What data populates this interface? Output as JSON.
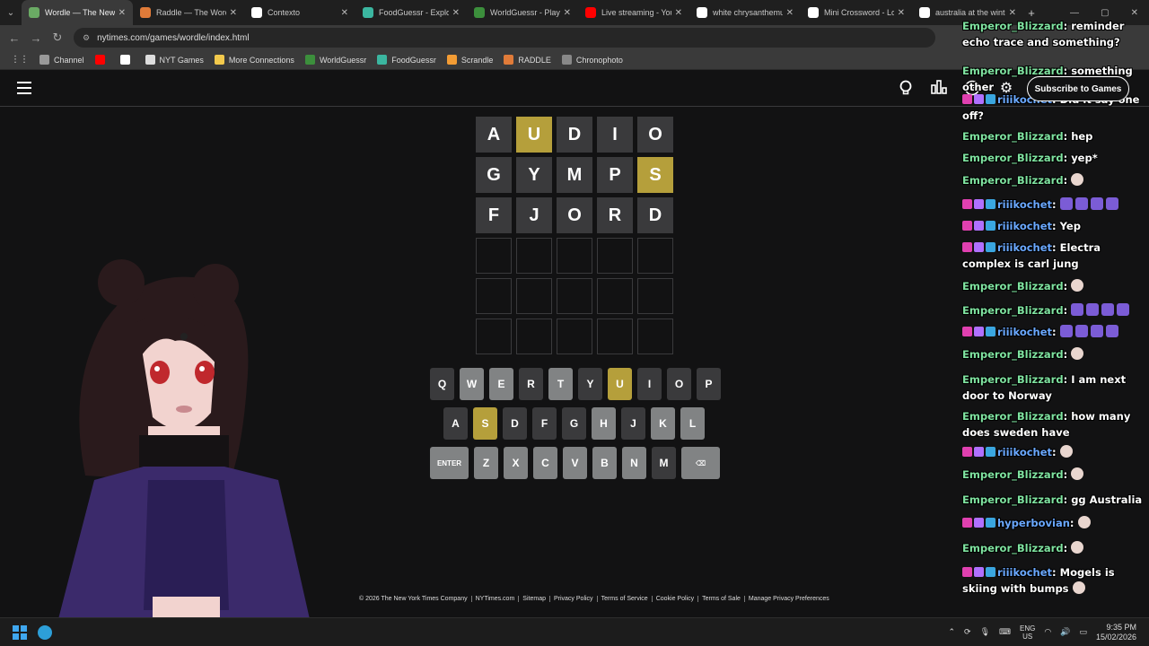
{
  "browser": {
    "tabs": [
      {
        "title": "Wordle — The New Y",
        "icon": "wordle-icon",
        "color": "#6aaa64",
        "active": true
      },
      {
        "title": "Raddle — The Word",
        "icon": "raddle-icon",
        "color": "#e07b39",
        "active": false
      },
      {
        "title": "Contexto",
        "icon": "contexto-icon",
        "color": "#ffffff",
        "active": false
      },
      {
        "title": "FoodGuessr - Explore",
        "icon": "foodguessr-icon",
        "color": "#3bb6a0",
        "active": false
      },
      {
        "title": "WorldGuessr - Play G",
        "icon": "worldguessr-icon",
        "color": "#3c8f3c",
        "active": false
      },
      {
        "title": "Live streaming - YouT",
        "icon": "youtube-icon",
        "color": "#ff0000",
        "active": false
      },
      {
        "title": "white chrysanthemum",
        "icon": "google-icon",
        "color": "#ffffff",
        "active": false
      },
      {
        "title": "Mini Crossword - Los",
        "icon": "nyt-icon",
        "color": "#ffffff",
        "active": false
      },
      {
        "title": "australia at the winte",
        "icon": "google-icon",
        "color": "#ffffff",
        "active": false
      }
    ],
    "url": "nytimes.com/games/wordle/index.html",
    "bookmarks": [
      {
        "label": "Channel",
        "icon": "folder-icon",
        "color": "#999999"
      },
      {
        "label": "",
        "icon": "youtube-icon",
        "color": "#ff0000"
      },
      {
        "label": "",
        "icon": "x-icon",
        "color": "#ffffff"
      },
      {
        "label": "NYT Games",
        "icon": "nyt-icon",
        "color": "#dddddd"
      },
      {
        "label": "More Connections",
        "icon": "connections-icon",
        "color": "#f2c94c"
      },
      {
        "label": "WorldGuessr",
        "icon": "worldguessr-icon",
        "color": "#3c8f3c"
      },
      {
        "label": "FoodGuessr",
        "icon": "foodguessr-icon",
        "color": "#3bb6a0"
      },
      {
        "label": "Scrandle",
        "icon": "scrandle-icon",
        "color": "#f39c34"
      },
      {
        "label": "RADDLE",
        "icon": "raddle-icon",
        "color": "#e07b39"
      },
      {
        "label": "Chronophoto",
        "icon": "camera-icon",
        "color": "#888888"
      }
    ]
  },
  "header": {
    "subscribe_label": "Subscribe to Games"
  },
  "board": {
    "rows": [
      [
        {
          "l": "A",
          "s": "absent"
        },
        {
          "l": "U",
          "s": "present"
        },
        {
          "l": "D",
          "s": "absent"
        },
        {
          "l": "I",
          "s": "absent"
        },
        {
          "l": "O",
          "s": "absent"
        }
      ],
      [
        {
          "l": "G",
          "s": "absent"
        },
        {
          "l": "Y",
          "s": "absent"
        },
        {
          "l": "M",
          "s": "absent"
        },
        {
          "l": "P",
          "s": "absent"
        },
        {
          "l": "S",
          "s": "present"
        }
      ],
      [
        {
          "l": "F",
          "s": "absent"
        },
        {
          "l": "J",
          "s": "absent"
        },
        {
          "l": "O",
          "s": "absent"
        },
        {
          "l": "R",
          "s": "absent"
        },
        {
          "l": "D",
          "s": "absent"
        }
      ],
      [
        {
          "l": "",
          "s": "empty"
        },
        {
          "l": "",
          "s": "empty"
        },
        {
          "l": "",
          "s": "empty"
        },
        {
          "l": "",
          "s": "empty"
        },
        {
          "l": "",
          "s": "empty"
        }
      ],
      [
        {
          "l": "",
          "s": "empty"
        },
        {
          "l": "",
          "s": "empty"
        },
        {
          "l": "",
          "s": "empty"
        },
        {
          "l": "",
          "s": "empty"
        },
        {
          "l": "",
          "s": "empty"
        }
      ],
      [
        {
          "l": "",
          "s": "empty"
        },
        {
          "l": "",
          "s": "empty"
        },
        {
          "l": "",
          "s": "empty"
        },
        {
          "l": "",
          "s": "empty"
        },
        {
          "l": "",
          "s": "empty"
        }
      ]
    ]
  },
  "keyboard": {
    "rows": [
      [
        {
          "k": "Q",
          "s": "absent"
        },
        {
          "k": "W",
          "s": "unused"
        },
        {
          "k": "E",
          "s": "unused"
        },
        {
          "k": "R",
          "s": "absent"
        },
        {
          "k": "T",
          "s": "unused"
        },
        {
          "k": "Y",
          "s": "absent"
        },
        {
          "k": "U",
          "s": "present"
        },
        {
          "k": "I",
          "s": "absent"
        },
        {
          "k": "O",
          "s": "absent"
        },
        {
          "k": "P",
          "s": "absent"
        }
      ],
      [
        {
          "k": "A",
          "s": "absent"
        },
        {
          "k": "S",
          "s": "present"
        },
        {
          "k": "D",
          "s": "absent"
        },
        {
          "k": "F",
          "s": "absent"
        },
        {
          "k": "G",
          "s": "absent"
        },
        {
          "k": "H",
          "s": "unused"
        },
        {
          "k": "J",
          "s": "absent"
        },
        {
          "k": "K",
          "s": "unused"
        },
        {
          "k": "L",
          "s": "unused"
        }
      ],
      [
        {
          "k": "ENTER",
          "s": "unused",
          "wide": true
        },
        {
          "k": "Z",
          "s": "unused"
        },
        {
          "k": "X",
          "s": "unused"
        },
        {
          "k": "C",
          "s": "unused"
        },
        {
          "k": "V",
          "s": "unused"
        },
        {
          "k": "B",
          "s": "unused"
        },
        {
          "k": "N",
          "s": "unused"
        },
        {
          "k": "M",
          "s": "absent"
        },
        {
          "k": "⌫",
          "s": "unused",
          "wide": true
        }
      ]
    ]
  },
  "footer": {
    "links": [
      "© 2026 The New York Times Company",
      "NYTimes.com",
      "Sitemap",
      "Privacy Policy",
      "Terms of Service",
      "Cookie Policy",
      "Terms of Sale",
      "Manage Privacy Preferences"
    ]
  },
  "chat": {
    "messages": [
      {
        "user": "Emperor_Blizzard",
        "kind": "g",
        "badges": false,
        "text": "reminder echo trace and something?",
        "emote": ""
      },
      {
        "user": "Emperor_Blizzard",
        "kind": "g",
        "badges": false,
        "text": "something other",
        "emote": ""
      },
      {
        "user": "riiikochet",
        "kind": "b",
        "badges": true,
        "text": "Did it say one off?",
        "emote": ""
      },
      {
        "user": "Emperor_Blizzard",
        "kind": "g",
        "badges": false,
        "text": "hep",
        "emote": ""
      },
      {
        "user": "Emperor_Blizzard",
        "kind": "g",
        "badges": false,
        "text": "yep*",
        "emote": ""
      },
      {
        "user": "Emperor_Blizzard",
        "kind": "g",
        "badges": false,
        "text": "",
        "emote": "face"
      },
      {
        "user": "riiikochet",
        "kind": "b",
        "badges": true,
        "text": "",
        "emote": "rockets"
      },
      {
        "user": "riiikochet",
        "kind": "b",
        "badges": true,
        "text": "Yep",
        "emote": ""
      },
      {
        "user": "riiikochet",
        "kind": "b",
        "badges": true,
        "text": "Electra complex is carl jung",
        "emote": ""
      },
      {
        "user": "Emperor_Blizzard",
        "kind": "g",
        "badges": false,
        "text": "",
        "emote": "face"
      },
      {
        "user": "Emperor_Blizzard",
        "kind": "g",
        "badges": false,
        "text": "",
        "emote": "rockets"
      },
      {
        "user": "riiikochet",
        "kind": "b",
        "badges": true,
        "text": "",
        "emote": "rockets"
      },
      {
        "user": "Emperor_Blizzard",
        "kind": "g",
        "badges": false,
        "text": "",
        "emote": "face"
      },
      {
        "user": "Emperor_Blizzard",
        "kind": "g",
        "badges": false,
        "text": "I am next door to Norway",
        "emote": ""
      },
      {
        "user": "Emperor_Blizzard",
        "kind": "g",
        "badges": false,
        "text": "how many does sweden have",
        "emote": ""
      },
      {
        "user": "riiikochet",
        "kind": "b",
        "badges": true,
        "text": "",
        "emote": "face"
      },
      {
        "user": "Emperor_Blizzard",
        "kind": "g",
        "badges": false,
        "text": "",
        "emote": "face"
      },
      {
        "user": "Emperor_Blizzard",
        "kind": "g",
        "badges": false,
        "text": "gg Australia",
        "emote": ""
      },
      {
        "user": "hyperbovian",
        "kind": "b",
        "badges": true,
        "text": "",
        "emote": "face"
      },
      {
        "user": "Emperor_Blizzard",
        "kind": "g",
        "badges": false,
        "text": "",
        "emote": "face"
      },
      {
        "user": "riiikochet",
        "kind": "b",
        "badges": true,
        "text": "Mogels is skiing with bumps",
        "emote": "face"
      }
    ]
  },
  "taskbar": {
    "lang_top": "ENG",
    "lang_bottom": "US",
    "time": "9:35 PM",
    "date": "15/02/2026"
  }
}
